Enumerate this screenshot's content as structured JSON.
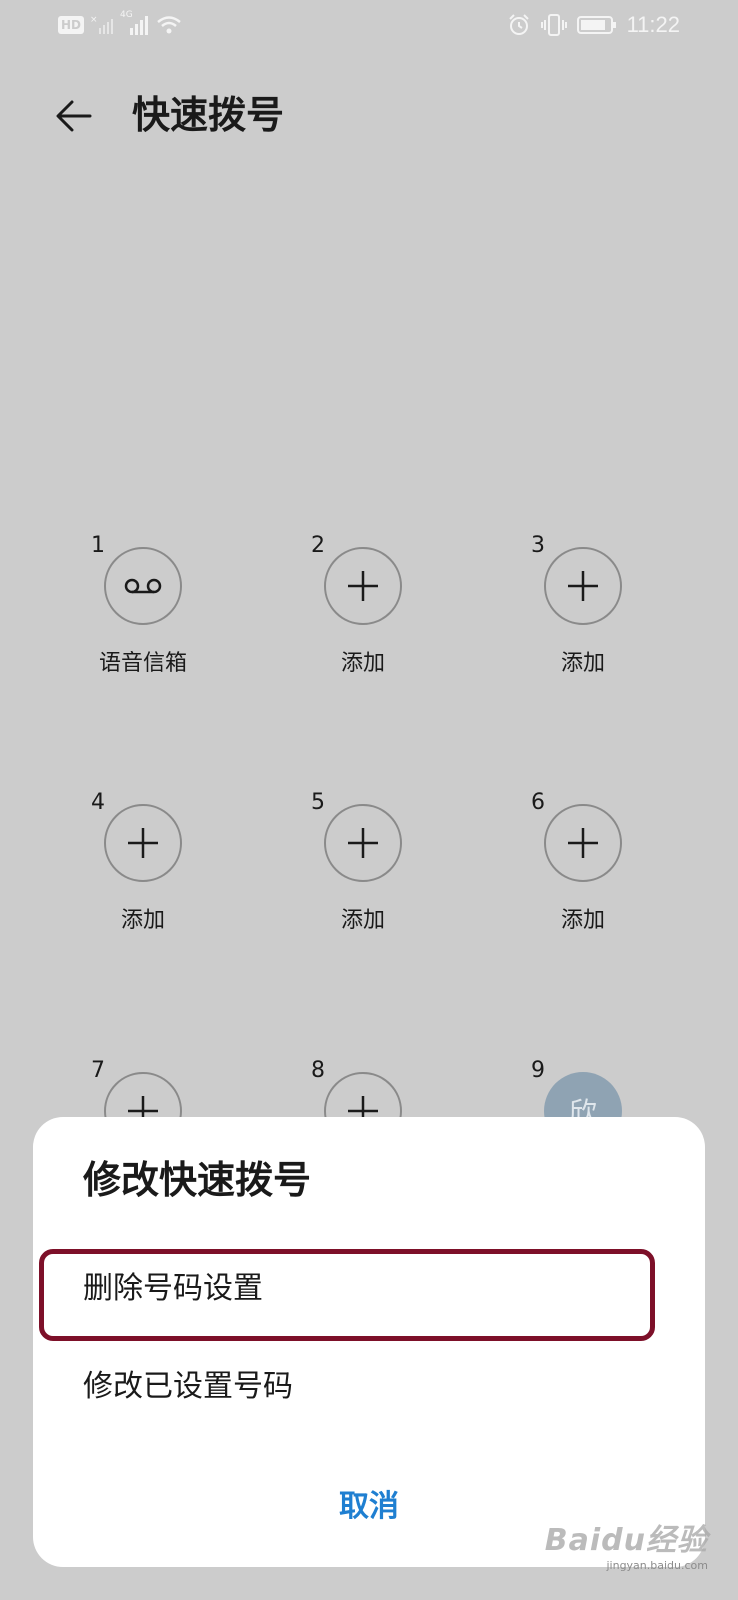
{
  "status_bar": {
    "hd_label": "HD",
    "network": "4G",
    "time": "11:22"
  },
  "header": {
    "back_icon": "arrow-left-icon",
    "title": "快速拨号"
  },
  "speed_dial": [
    {
      "number": "1",
      "label": "语音信箱",
      "icon": "voicemail-icon"
    },
    {
      "number": "2",
      "label": "添加",
      "icon": "plus-icon"
    },
    {
      "number": "3",
      "label": "添加",
      "icon": "plus-icon"
    },
    {
      "number": "4",
      "label": "添加",
      "icon": "plus-icon"
    },
    {
      "number": "5",
      "label": "添加",
      "icon": "plus-icon"
    },
    {
      "number": "6",
      "label": "添加",
      "icon": "plus-icon"
    },
    {
      "number": "7",
      "label": "",
      "icon": "plus-icon"
    },
    {
      "number": "8",
      "label": "",
      "icon": "plus-icon"
    },
    {
      "number": "9",
      "label": "",
      "avatar_text": "欣"
    }
  ],
  "dialog": {
    "title": "修改快速拨号",
    "options": [
      {
        "label": "删除号码设置"
      },
      {
        "label": "修改已设置号码"
      }
    ],
    "cancel_label": "取消"
  },
  "watermark": {
    "logo": "Baidu经验",
    "url": "jingyan.baidu.com"
  },
  "colors": {
    "background": "#cccccc",
    "dialog": "#ffffff",
    "accent": "#1f7fd1",
    "highlight": "#7d1029"
  }
}
